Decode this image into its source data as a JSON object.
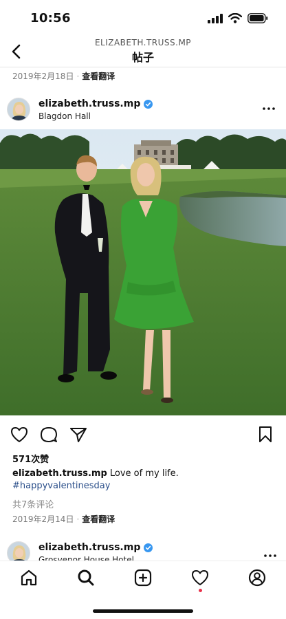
{
  "status_bar": {
    "time": "10:56"
  },
  "header": {
    "subtitle": "ELIZABETH.TRUSS.MP",
    "title": "帖子"
  },
  "previous_post": {
    "date": "2019年2月18日",
    "translate_label": "查看翻译"
  },
  "post": {
    "username": "elizabeth.truss.mp",
    "location": "Blagdon Hall",
    "likes": "571次赞",
    "caption_username": "elizabeth.truss.mp",
    "caption_text": "Love of my life.",
    "hashtag": "#happyvalentinesday",
    "comments_link": "共7条评论",
    "date": "2019年2月14日",
    "translate_label": "查看翻译"
  },
  "next_post": {
    "username": "elizabeth.truss.mp",
    "location": "Grosvenor House Hotel"
  },
  "colors": {
    "verified": "#3897f0",
    "hashtag": "#2b4f8a",
    "notification_dot": "#e8324b"
  },
  "icons": {
    "status": [
      "signal-icon",
      "wifi-icon",
      "battery-icon"
    ],
    "actions": [
      "heart-icon",
      "comment-icon",
      "share-icon",
      "bookmark-icon"
    ],
    "tabs": [
      "home-icon",
      "search-icon",
      "create-icon",
      "activity-icon",
      "profile-icon"
    ]
  }
}
